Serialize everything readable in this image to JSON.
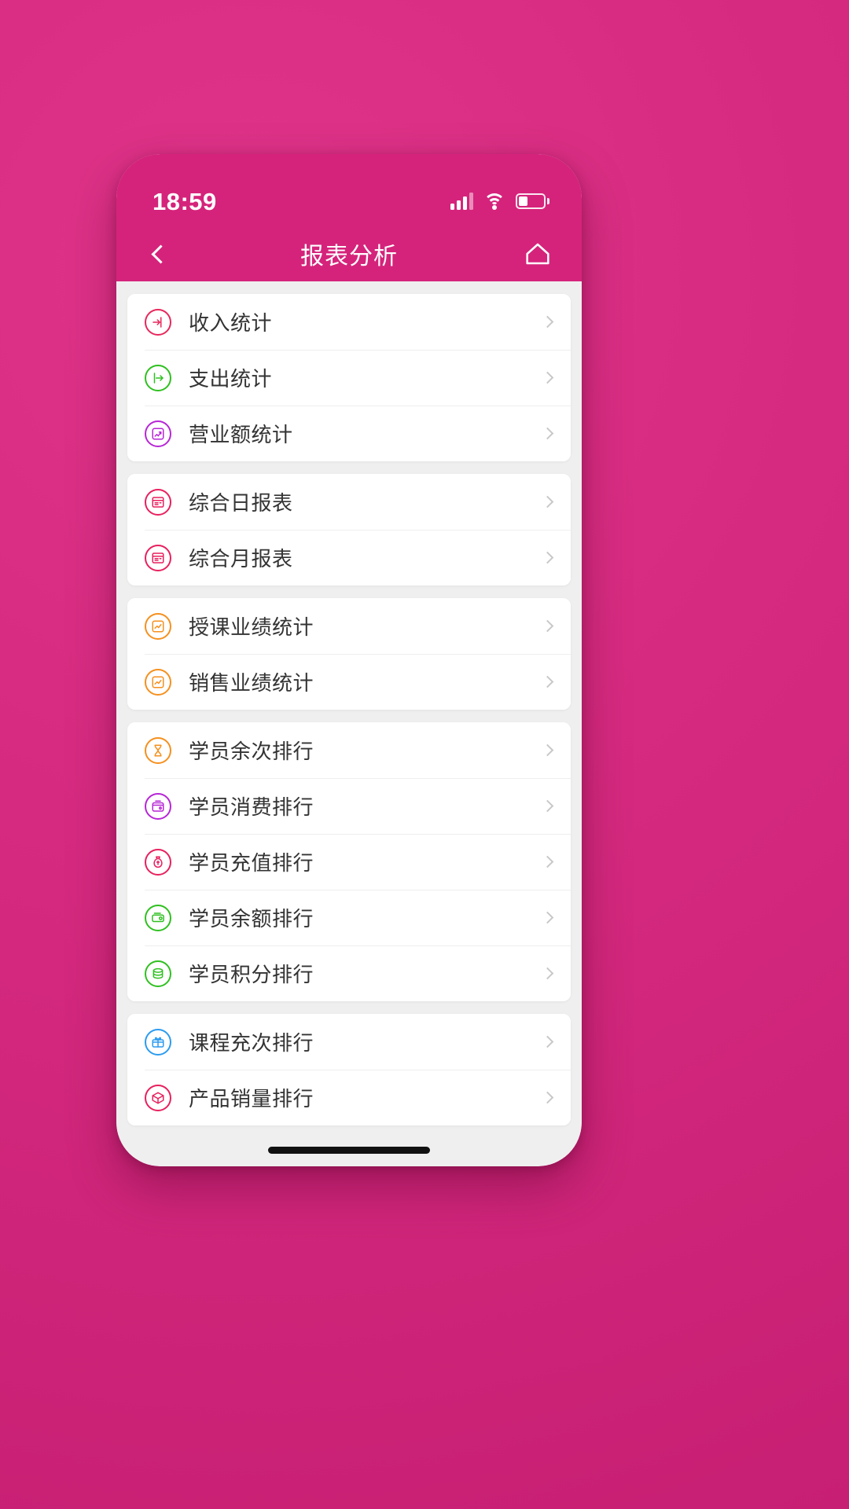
{
  "theme": {
    "backdrop_color": "#d7297e",
    "header_color": "#d5237b",
    "page_background": "#efefef",
    "card_background": "#ffffff",
    "label_color": "#333333",
    "chevron_color": "#c8c8c8"
  },
  "status_bar": {
    "time": "18:59",
    "signal_icon": "signal-bars-icon",
    "wifi_icon": "wifi-icon",
    "battery_icon": "battery-icon",
    "battery_level_percent": 35
  },
  "nav": {
    "back_icon": "chevron-left-icon",
    "title": "报表分析",
    "home_icon": "home-icon"
  },
  "groups": [
    {
      "group_name": "statistics",
      "items": [
        {
          "label": "收入统计",
          "icon": "arrow-into-box-icon",
          "color": "#e8275a"
        },
        {
          "label": "支出统计",
          "icon": "arrow-out-of-box-icon",
          "color": "#2fc020"
        },
        {
          "label": "营业额统计",
          "icon": "chart-growth-icon",
          "color": "#b726d6"
        }
      ]
    },
    {
      "group_name": "comprehensive-reports",
      "items": [
        {
          "label": "综合日报表",
          "icon": "report-page-icon",
          "color": "#e8205e"
        },
        {
          "label": "综合月报表",
          "icon": "report-page-icon",
          "color": "#e8205e"
        }
      ]
    },
    {
      "group_name": "performance",
      "items": [
        {
          "label": "授课业绩统计",
          "icon": "line-chart-box-icon",
          "color": "#f5901e"
        },
        {
          "label": "销售业绩统计",
          "icon": "line-chart-box-icon",
          "color": "#f5901e"
        }
      ]
    },
    {
      "group_name": "student-rankings",
      "items": [
        {
          "label": "学员余次排行",
          "icon": "hourglass-icon",
          "color": "#f5901e"
        },
        {
          "label": "学员消费排行",
          "icon": "wallet-spend-icon",
          "color": "#b726d6"
        },
        {
          "label": "学员充值排行",
          "icon": "money-bag-icon",
          "color": "#e8205e"
        },
        {
          "label": "学员余额排行",
          "icon": "balance-coin-icon",
          "color": "#2fc020"
        },
        {
          "label": "学员积分排行",
          "icon": "coins-stack-icon",
          "color": "#2fc020"
        }
      ]
    },
    {
      "group_name": "course-rankings",
      "items": [
        {
          "label": "课程充次排行",
          "icon": "gift-box-icon",
          "color": "#2b9bf0"
        },
        {
          "label": "产品销量排行",
          "icon": "product-icon",
          "color": "#e8205e"
        }
      ]
    }
  ],
  "home_indicator": "home-indicator"
}
